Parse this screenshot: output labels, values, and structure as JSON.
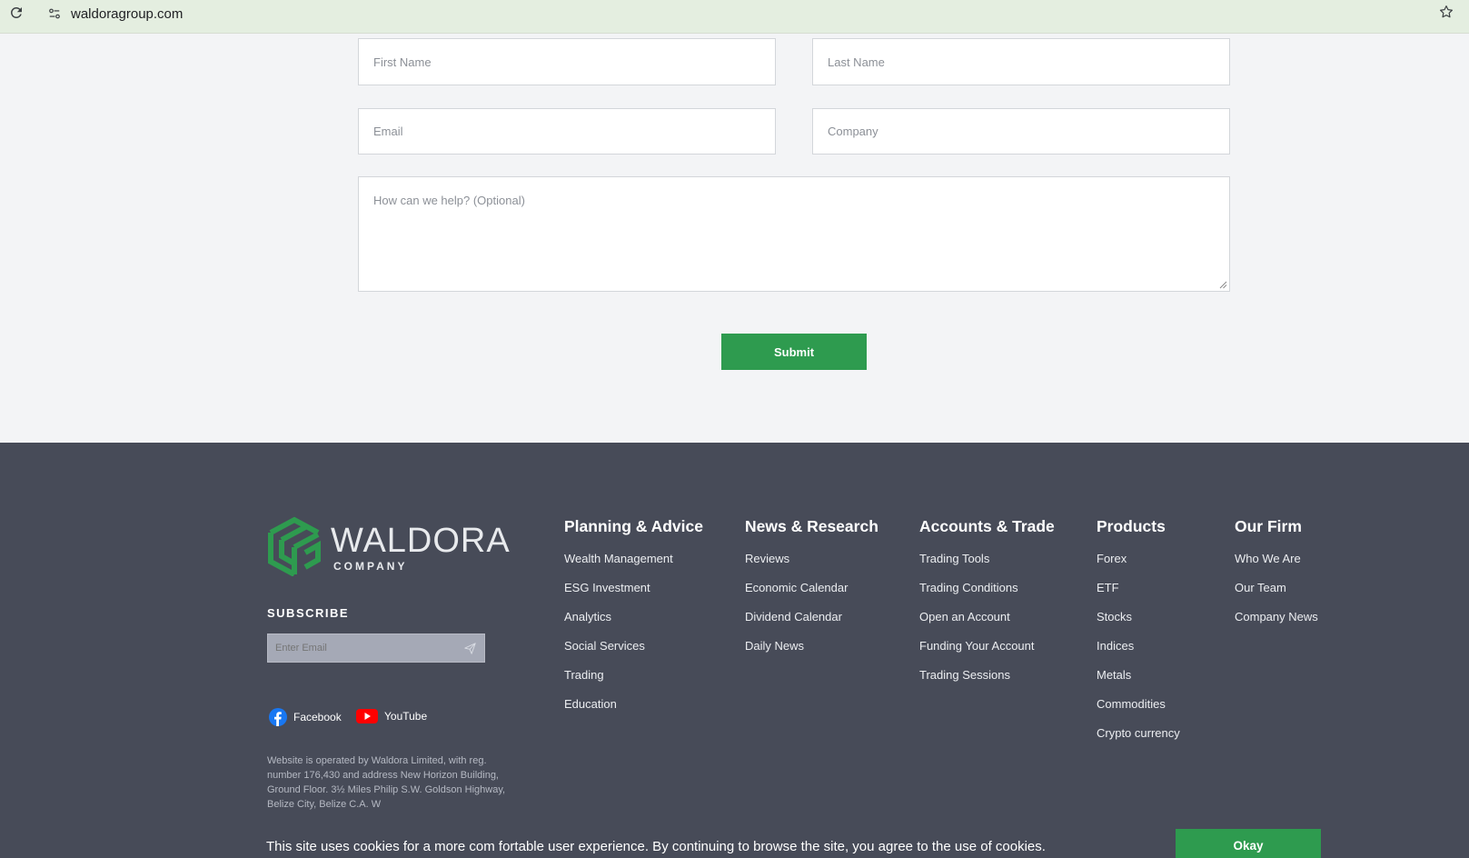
{
  "browser": {
    "url": "waldoragroup.com"
  },
  "form": {
    "first_name_placeholder": "First Name",
    "last_name_placeholder": "Last Name",
    "email_placeholder": "Email",
    "company_placeholder": "Company",
    "message_placeholder": "How can we help? (Optional)",
    "submit_label": "Submit"
  },
  "footer": {
    "brand_name": "WALDORA",
    "brand_sub": "COMPANY",
    "subscribe_title": "SUBSCRIBE",
    "subscribe_placeholder": "Enter Email",
    "social": [
      {
        "label": "Facebook",
        "icon": "facebook-icon"
      },
      {
        "label": "YouTube",
        "icon": "youtube-icon"
      }
    ],
    "legal": "Website is operated by Waldora Limited, with reg. number 176,430 and address New Horizon Building, Ground Floor. 3½ Miles Philip S.W. Goldson Highway, Belize City, Belize C.A. W",
    "columns": [
      {
        "title": "Planning & Advice",
        "items": [
          "Wealth Management",
          "ESG Investment",
          "Analytics",
          "Social Services",
          "Trading",
          "Education"
        ]
      },
      {
        "title": "News & Research",
        "items": [
          "Reviews",
          "Economic Calendar",
          "Dividend Calendar",
          "Daily News"
        ]
      },
      {
        "title": "Accounts & Trade",
        "items": [
          "Trading Tools",
          "Trading Conditions",
          "Open an Account",
          "Funding Your Account",
          "Trading Sessions"
        ]
      },
      {
        "title": "Products",
        "items": [
          "Forex",
          "ETF",
          "Stocks",
          "Indices",
          "Metals",
          "Commodities",
          "Crypto currency"
        ]
      },
      {
        "title": "Our Firm",
        "items": [
          "Who We Are",
          "Our Team",
          "Company News"
        ]
      }
    ],
    "cookie_text": "This site uses cookies for a more com fortable user experience. By continuing to browse the site, you agree to the use of cookies.",
    "okay_label": "Okay"
  },
  "colors": {
    "accent_green": "#2e9b4f",
    "footer_bg": "#474b58",
    "page_bg": "#f3f4f6"
  }
}
